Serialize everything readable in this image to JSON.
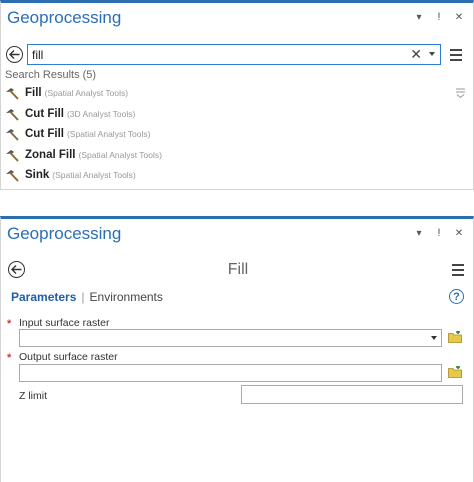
{
  "search_pane": {
    "title": "Geoprocessing",
    "controls": {
      "dropdown": "▾",
      "pin": "ⵑ",
      "close": "✕"
    },
    "search": {
      "value": "fill",
      "clear_glyph": "✕"
    },
    "results_header": "Search Results (5)",
    "results": [
      {
        "name": "Fill",
        "source": "(Spatial Analyst Tools)"
      },
      {
        "name": "Cut Fill",
        "source": "(3D Analyst Tools)"
      },
      {
        "name": "Cut Fill",
        "source": "(Spatial Analyst Tools)"
      },
      {
        "name": "Zonal Fill",
        "source": "(Spatial Analyst Tools)"
      },
      {
        "name": "Sink",
        "source": "(Spatial Analyst Tools)"
      }
    ],
    "icons": {
      "back": "back-arrow-icon",
      "menu": "hamburger-menu-icon",
      "tool": "hammer-icon",
      "filter": "filter-icon"
    }
  },
  "tool_pane": {
    "title": "Geoprocessing",
    "controls": {
      "dropdown": "▾",
      "pin": "ⵑ",
      "close": "✕"
    },
    "tool_name": "Fill",
    "tabs": {
      "parameters": "Parameters",
      "environments": "Environments"
    },
    "help_glyph": "?",
    "params": {
      "input_label": "Input surface raster",
      "output_label": "Output surface raster",
      "zlimit_label": "Z limit",
      "required_marker": "*",
      "input_value": "",
      "output_value": "",
      "zlimit_value": ""
    }
  },
  "colors": {
    "accent": "#2b6fb0",
    "title_text": "#2a6fb5",
    "required": "#d33333",
    "folder": "#e8c84a"
  }
}
